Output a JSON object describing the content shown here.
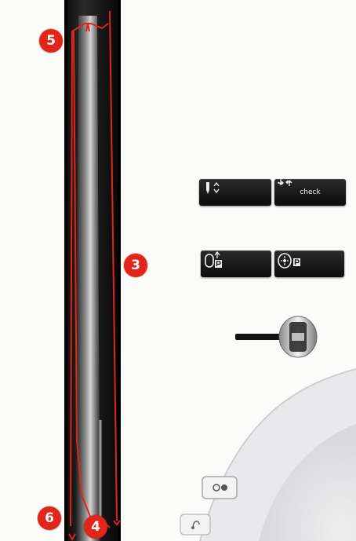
{
  "callouts": [
    {
      "id": "m5",
      "number": "5"
    },
    {
      "id": "m3",
      "number": "3"
    },
    {
      "id": "m6",
      "number": "6"
    },
    {
      "id": "m4",
      "number": "4"
    }
  ],
  "buttons": {
    "check_label": "check"
  },
  "icons": {
    "needle_up_down": "needle-up-down-icon",
    "check_arrows": "check-arrows-icon",
    "presser_foot_up": "presser-foot-up-icon",
    "pattern_start": "pattern-start-icon",
    "thread_cutter": "thread-cutter-icon",
    "bobbin_winder": "bobbin-winder-icon"
  },
  "colors": {
    "thread_path": "#e1251b",
    "marker": "#e1251b",
    "machine_body": "#fbfbfa"
  }
}
